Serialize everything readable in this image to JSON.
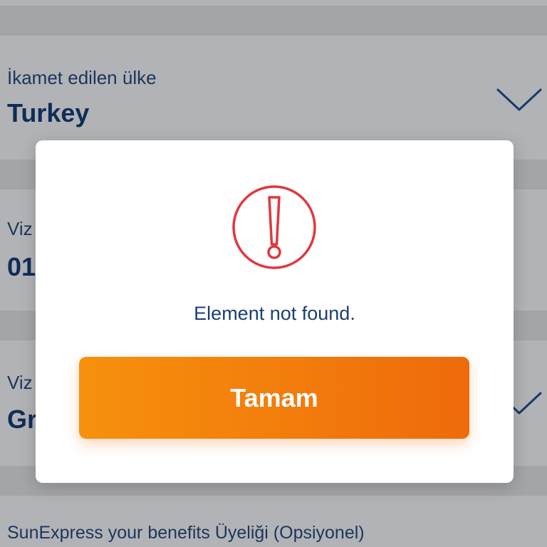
{
  "form": {
    "residence_country": {
      "label": "İkamet edilen ülke",
      "value": "Turkey",
      "icon": "chevron-down-icon"
    },
    "visa_date": {
      "label_visible": "Viz",
      "value_visible": "01"
    },
    "visa_country": {
      "label_visible": "Viz",
      "value_visible": "Gr",
      "icon": "chevron-down-icon"
    },
    "membership": {
      "label": "SunExpress your benefits Üyeliği (Opsiyonel)"
    }
  },
  "dialog": {
    "icon": "exclamation-circle-icon",
    "message": "Element not found.",
    "button_label": "Tamam"
  },
  "colors": {
    "overlay": "#a4a5a8",
    "text_dark_blue": "#0f2d57",
    "alert_red": "#e0383e",
    "button_orange_start": "#f7910d",
    "button_orange_end": "#ee6b0b"
  }
}
